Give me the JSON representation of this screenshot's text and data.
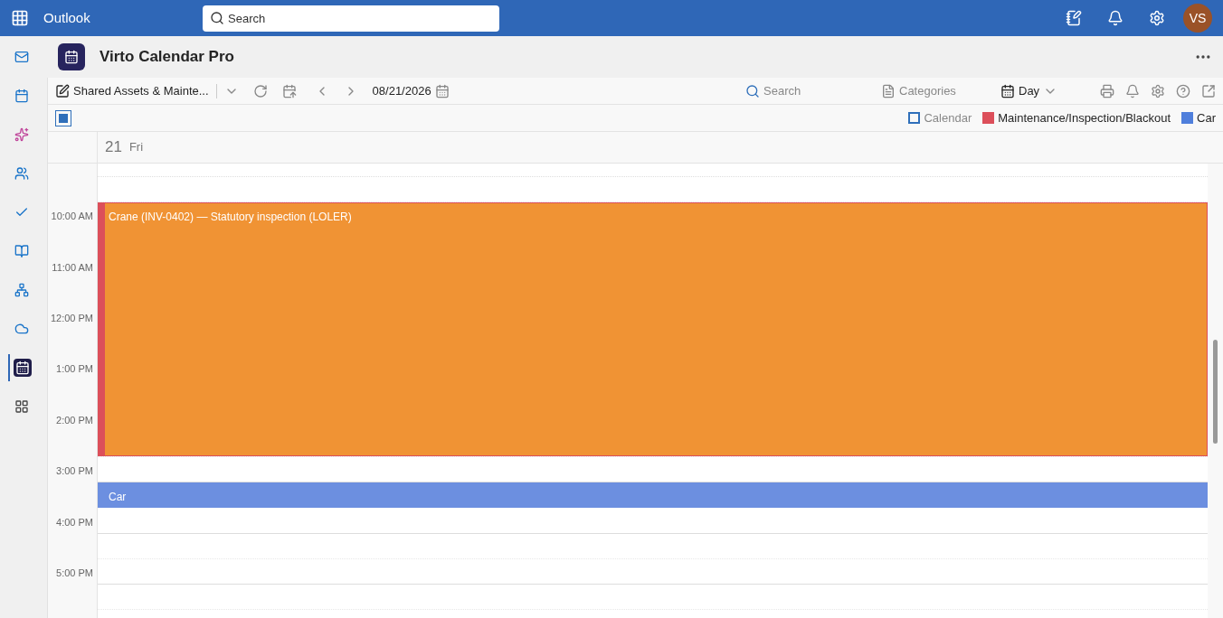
{
  "topbar": {
    "app_name": "Outlook",
    "search": {
      "placeholder": "Search"
    },
    "avatar": "VS"
  },
  "rail": [
    {
      "kind": "mail",
      "selected": false
    },
    {
      "kind": "calendar",
      "selected": false
    },
    {
      "kind": "copilot",
      "selected": false
    },
    {
      "kind": "people",
      "selected": false
    },
    {
      "kind": "todo",
      "selected": false
    },
    {
      "kind": "files",
      "selected": false
    },
    {
      "kind": "org",
      "selected": false
    },
    {
      "kind": "cloud",
      "selected": false
    },
    {
      "kind": "virto",
      "selected": true
    },
    {
      "kind": "apps",
      "selected": false
    }
  ],
  "app_header": {
    "title": "Virto Calendar Pro"
  },
  "toolbar": {
    "calendar_name": "Shared Assets & Mainte...",
    "date": "08/21/2026",
    "search": {
      "placeholder": "Search"
    },
    "categories": "Categories",
    "view": "Day"
  },
  "legend": {
    "select_all": {
      "checked": true
    },
    "items": [
      {
        "label": "Calendar",
        "kind": "outline",
        "color": "#2f6fba"
      },
      {
        "label": "Maintenance/Inspection/Blackout",
        "kind": "filled",
        "color": "#dc4f5a"
      },
      {
        "label": "Car",
        "kind": "filled",
        "color": "#4f7fdc"
      }
    ]
  },
  "day_header": {
    "day_number": "21",
    "weekday": "Fri"
  },
  "time_labels": [
    "10:00 AM",
    "11:00 AM",
    "12:00 PM",
    "1:00 PM",
    "2:00 PM",
    "3:00 PM",
    "4:00 PM",
    "5:00 PM"
  ],
  "events": [
    {
      "title": "Crane (INV-0402) — Statutory inspection (LOLER)",
      "kind": "barred",
      "color": "#dc4f5a"
    },
    {
      "title": "Car",
      "kind": "plain",
      "color": "#6c8fe0"
    }
  ]
}
